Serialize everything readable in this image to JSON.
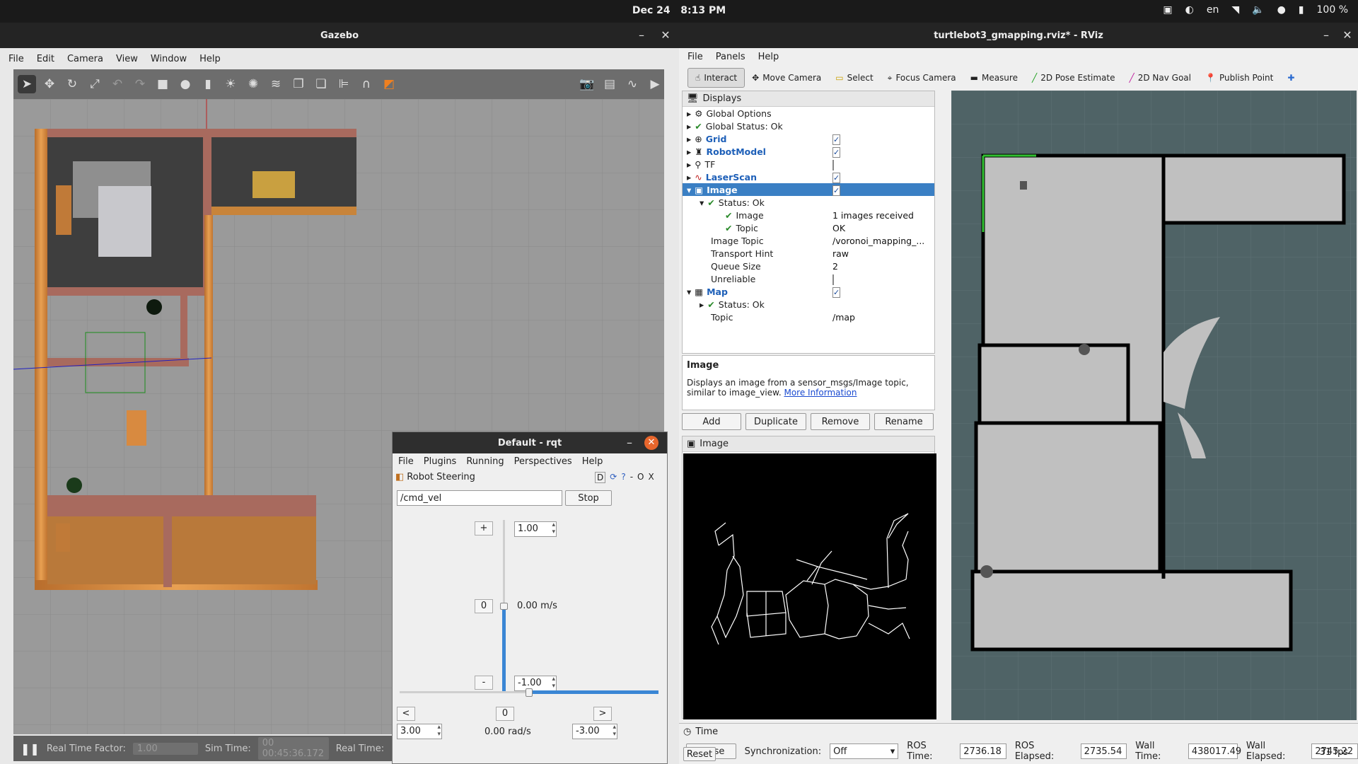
{
  "topbar": {
    "date": "Dec 24",
    "time": "8:13 PM",
    "lang": "en",
    "battery": "100 %"
  },
  "gazebo": {
    "title": "Gazebo",
    "menu": [
      "File",
      "Edit",
      "Camera",
      "View",
      "Window",
      "Help"
    ],
    "status": {
      "rtf_label": "Real Time Factor:",
      "rtf": "1.00",
      "sim_label": "Sim Time:",
      "sim": "00 00:45:36.172",
      "real_label": "Real Time:"
    }
  },
  "rviz": {
    "title": "turtlebot3_gmapping.rviz* - RViz",
    "menu": [
      "File",
      "Panels",
      "Help"
    ],
    "tools": [
      "Interact",
      "Move Camera",
      "Select",
      "Focus Camera",
      "Measure",
      "2D Pose Estimate",
      "2D Nav Goal",
      "Publish Point"
    ],
    "displays_title": "Displays",
    "rows": [
      {
        "label": "Global Options",
        "value": ""
      },
      {
        "label": "Global Status: Ok",
        "value": ""
      },
      {
        "label": "Grid",
        "value": ""
      },
      {
        "label": "RobotModel",
        "value": ""
      },
      {
        "label": "TF",
        "value": ""
      },
      {
        "label": "LaserScan",
        "value": ""
      },
      {
        "label": "Image",
        "value": ""
      },
      {
        "label": "Status: Ok",
        "value": ""
      },
      {
        "label": "Image",
        "value": "1 images received"
      },
      {
        "label": "Topic",
        "value": "OK"
      },
      {
        "label": "Image Topic",
        "value": "/voronoi_mapping_..."
      },
      {
        "label": "Transport Hint",
        "value": "raw"
      },
      {
        "label": "Queue Size",
        "value": "2"
      },
      {
        "label": "Unreliable",
        "value": ""
      },
      {
        "label": "Map",
        "value": ""
      },
      {
        "label": "Status: Ok",
        "value": ""
      },
      {
        "label": "Topic",
        "value": "/map"
      }
    ],
    "desc_title": "Image",
    "desc_text": "Displays an image from a sensor_msgs/Image topic, similar to image_view.",
    "desc_link": "More Information",
    "buttons": [
      "Add",
      "Duplicate",
      "Remove",
      "Rename"
    ],
    "image_panel": "Image",
    "time": {
      "title": "Time",
      "pause": "Pause",
      "sync_label": "Synchronization:",
      "sync": "Off",
      "ros_time_label": "ROS Time:",
      "ros_time": "2736.18",
      "ros_elapsed_label": "ROS Elapsed:",
      "ros_elapsed": "2735.54",
      "wall_time_label": "Wall Time:",
      "wall_time": "438017.49",
      "wall_elapsed_label": "Wall Elapsed:",
      "wall_elapsed": "2745.22",
      "reset": "Reset",
      "fps": "31 fps"
    }
  },
  "rqt": {
    "title": "Default - rqt",
    "menu": [
      "File",
      "Plugins",
      "Running",
      "Perspectives",
      "Help"
    ],
    "plugin": "Robot Steering",
    "plugin_ctrl": "D",
    "topic": "/cmd_vel",
    "stop": "Stop",
    "plus": "+",
    "zero": "0",
    "minus": "-",
    "lin_max": "1.00",
    "lin_min": "-1.00",
    "lin_value": "0.00 m/s",
    "left": "<",
    "right": ">",
    "ang_zero": "0",
    "ang_max": "3.00",
    "ang_min": "-3.00",
    "ang_value": "0.00 rad/s",
    "linear_level": 0.5,
    "angular_level": 0.5
  }
}
